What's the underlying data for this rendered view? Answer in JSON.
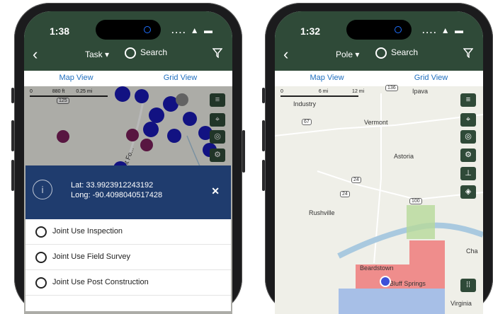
{
  "left_phone": {
    "time": "1:38",
    "status_icons": ".... ▲ ▬",
    "back_label": "‹",
    "picker_label": "Task",
    "search_label": "Search",
    "tabs": [
      {
        "label": "Map View",
        "active": true
      },
      {
        "label": "Grid View",
        "active": false
      }
    ],
    "scale": {
      "zero": "0",
      "mid": "880 ft",
      "end": "0.25 mi"
    },
    "road_label": "Kent Fo...",
    "shield": "125",
    "info": {
      "lat": "Lat: 33.9923912243192",
      "long": "Long: -90.4098040517428",
      "close": "✕",
      "icon": "i"
    },
    "options": [
      "Joint Use Inspection",
      "Joint Use Field Survey",
      "Joint Use Post Construction"
    ],
    "colors": {
      "header": "#2f4a38",
      "pin_blue": "#1a1ab5",
      "pin_purple": "#7b1f5a",
      "info_bg": "#1f3c6e"
    }
  },
  "right_phone": {
    "time": "1:32",
    "status_icons": ".... ▲ ▬",
    "back_label": "‹",
    "picker_label": "Pole",
    "search_label": "Search",
    "tabs": [
      {
        "label": "Map View",
        "active": true
      },
      {
        "label": "Grid View",
        "active": false
      }
    ],
    "scale": {
      "zero": "0",
      "mid": "6 mi",
      "end": "12 mi"
    },
    "places": [
      "Ipava",
      "Industry",
      "Vermont",
      "Astoria",
      "Rushville",
      "Beardstown",
      "Bluff Springs",
      "Virginia",
      "Cha"
    ],
    "shields": [
      "136",
      "67",
      "24",
      "24",
      "100"
    ],
    "colors": {
      "red_tile": "#ee7b7b",
      "blue_tile": "#9ab6e6",
      "green_tile": "#b7d99a"
    }
  }
}
